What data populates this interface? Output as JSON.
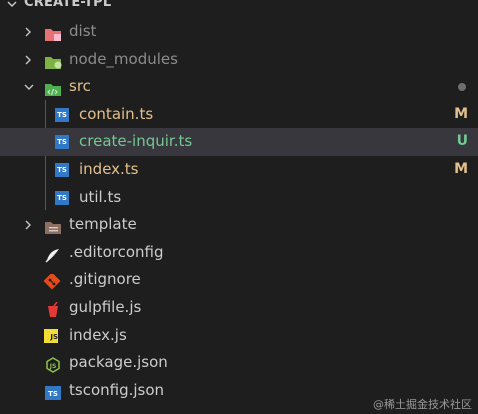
{
  "explorer": {
    "title": "CREATE-TPL",
    "items": [
      {
        "label": "dist",
        "type": "folder",
        "state": "collapsed"
      },
      {
        "label": "node_modules",
        "type": "folder",
        "state": "collapsed"
      },
      {
        "label": "src",
        "type": "folder",
        "state": "expanded",
        "badge": "●"
      },
      {
        "label": "contain.ts",
        "type": "ts",
        "badge": "M"
      },
      {
        "label": "create-inquir.ts",
        "type": "ts",
        "badge": "U"
      },
      {
        "label": "index.ts",
        "type": "ts",
        "badge": "M"
      },
      {
        "label": "util.ts",
        "type": "ts"
      },
      {
        "label": "template",
        "type": "folder",
        "state": "collapsed"
      },
      {
        "label": ".editorconfig",
        "type": "editorconfig"
      },
      {
        "label": ".gitignore",
        "type": "git"
      },
      {
        "label": "gulpfile.js",
        "type": "gulp"
      },
      {
        "label": "index.js",
        "type": "js"
      },
      {
        "label": "package.json",
        "type": "json"
      },
      {
        "label": "tsconfig.json",
        "type": "tsconfig"
      }
    ]
  },
  "icons": {
    "ts_text": "TS",
    "js_text": "JS",
    "json_text": "JS",
    "tsconfig_text": "TS"
  },
  "colors": {
    "background": "#1e1e1e",
    "selected": "#37373d",
    "modified": "#e2c08d",
    "untracked": "#73c991",
    "ts_blue": "#3178c6",
    "js_yellow": "#f1dd35"
  },
  "watermark": "@稀土掘金技术社区"
}
